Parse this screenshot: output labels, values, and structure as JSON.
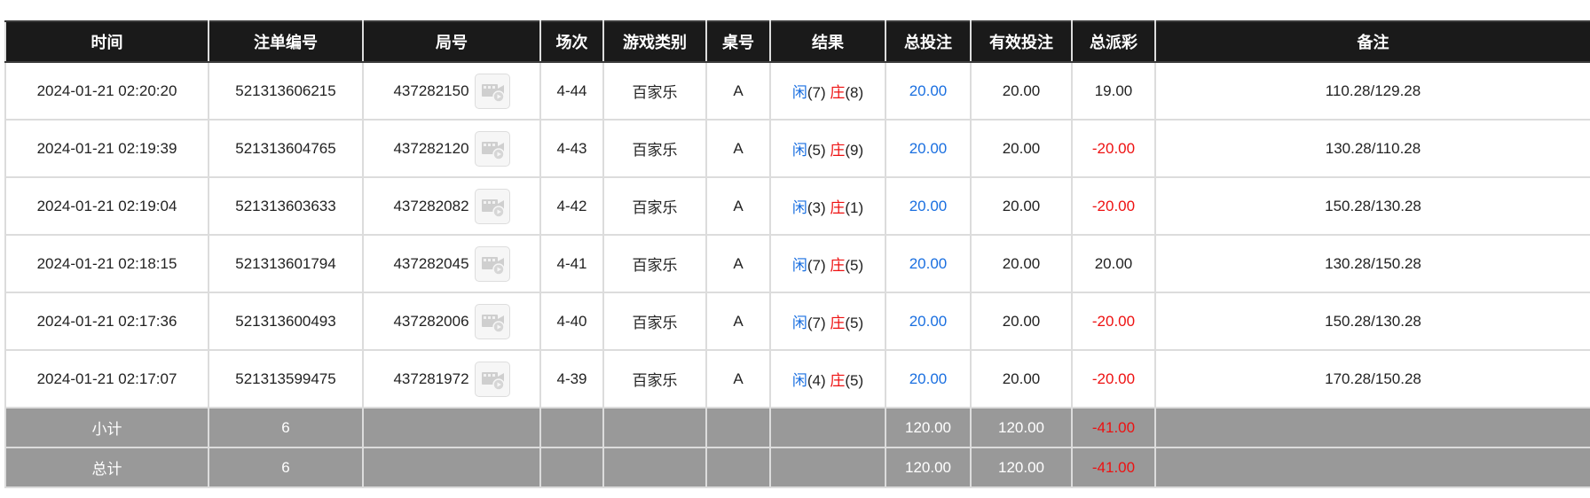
{
  "columns": [
    "时间",
    "注单编号",
    "局号",
    "场次",
    "游戏类别",
    "桌号",
    "结果",
    "总投注",
    "有效投注",
    "总派彩",
    "备注"
  ],
  "colors": {
    "header_bg": "#1a1a1a",
    "footer_bg": "#999999",
    "blue": "#1a6fe0",
    "red": "#ee1111"
  },
  "video_icon": "video-replay-icon",
  "rows": [
    {
      "time": "2024-01-21 02:20:20",
      "bet_id": "521313606215",
      "round_id": "437282150",
      "session": "4-44",
      "game": "百家乐",
      "table": "A",
      "player_label": "闲",
      "player_score": "(7)",
      "banker_label": "庄",
      "banker_score": "(8)",
      "total_bet": "20.00",
      "valid_bet": "20.00",
      "payout": "19.00",
      "payout_negative": false,
      "note": "110.28/129.28"
    },
    {
      "time": "2024-01-21 02:19:39",
      "bet_id": "521313604765",
      "round_id": "437282120",
      "session": "4-43",
      "game": "百家乐",
      "table": "A",
      "player_label": "闲",
      "player_score": "(5)",
      "banker_label": "庄",
      "banker_score": "(9)",
      "total_bet": "20.00",
      "valid_bet": "20.00",
      "payout": "-20.00",
      "payout_negative": true,
      "note": "130.28/110.28"
    },
    {
      "time": "2024-01-21 02:19:04",
      "bet_id": "521313603633",
      "round_id": "437282082",
      "session": "4-42",
      "game": "百家乐",
      "table": "A",
      "player_label": "闲",
      "player_score": "(3)",
      "banker_label": "庄",
      "banker_score": "(1)",
      "total_bet": "20.00",
      "valid_bet": "20.00",
      "payout": "-20.00",
      "payout_negative": true,
      "note": "150.28/130.28"
    },
    {
      "time": "2024-01-21 02:18:15",
      "bet_id": "521313601794",
      "round_id": "437282045",
      "session": "4-41",
      "game": "百家乐",
      "table": "A",
      "player_label": "闲",
      "player_score": "(7)",
      "banker_label": "庄",
      "banker_score": "(5)",
      "total_bet": "20.00",
      "valid_bet": "20.00",
      "payout": "20.00",
      "payout_negative": false,
      "note": "130.28/150.28"
    },
    {
      "time": "2024-01-21 02:17:36",
      "bet_id": "521313600493",
      "round_id": "437282006",
      "session": "4-40",
      "game": "百家乐",
      "table": "A",
      "player_label": "闲",
      "player_score": "(7)",
      "banker_label": "庄",
      "banker_score": "(5)",
      "total_bet": "20.00",
      "valid_bet": "20.00",
      "payout": "-20.00",
      "payout_negative": true,
      "note": "150.28/130.28"
    },
    {
      "time": "2024-01-21 02:17:07",
      "bet_id": "521313599475",
      "round_id": "437281972",
      "session": "4-39",
      "game": "百家乐",
      "table": "A",
      "player_label": "闲",
      "player_score": "(4)",
      "banker_label": "庄",
      "banker_score": "(5)",
      "total_bet": "20.00",
      "valid_bet": "20.00",
      "payout": "-20.00",
      "payout_negative": true,
      "note": "170.28/150.28"
    }
  ],
  "subtotal": {
    "label": "小计",
    "count": "6",
    "total_bet": "120.00",
    "valid_bet": "120.00",
    "payout": "-41.00"
  },
  "total": {
    "label": "总计",
    "count": "6",
    "total_bet": "120.00",
    "valid_bet": "120.00",
    "payout": "-41.00"
  }
}
